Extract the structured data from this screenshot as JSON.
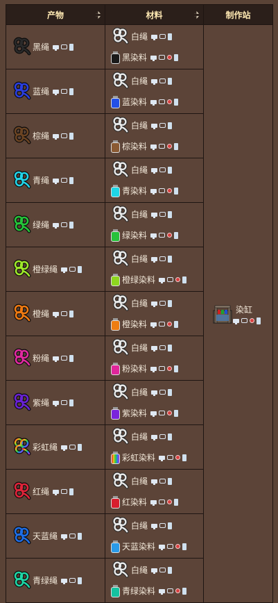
{
  "headers": {
    "product": "产物",
    "materials": "材料",
    "station": "制作站"
  },
  "station": {
    "name": "染缸"
  },
  "material_rope": "白绳",
  "rows": [
    {
      "product": "黑绳",
      "dye": "黑染料",
      "color": "#2a2a2a",
      "dyeColor": "#1a1a1a"
    },
    {
      "product": "蓝绳",
      "dye": "蓝染料",
      "color": "#2a3fe0",
      "dyeColor": "#2350e6"
    },
    {
      "product": "棕绳",
      "dye": "棕染料",
      "color": "#6b4423",
      "dyeColor": "#8a5a33"
    },
    {
      "product": "青绳",
      "dye": "青染料",
      "color": "#22d4e8",
      "dyeColor": "#1fd6e6"
    },
    {
      "product": "绿绳",
      "dye": "绿染料",
      "color": "#26c43a",
      "dyeColor": "#27c23a"
    },
    {
      "product": "橙绿绳",
      "dye": "橙绿染料",
      "color": "#9ee82a",
      "dyeColor": "#8ed61f"
    },
    {
      "product": "橙绳",
      "dye": "橙染料",
      "color": "#f07a12",
      "dyeColor": "#ee7d12"
    },
    {
      "product": "粉绳",
      "dye": "粉染料",
      "color": "#e02aa0",
      "dyeColor": "#e0269a"
    },
    {
      "product": "紫绳",
      "dye": "紫染料",
      "color": "#6a22d6",
      "dyeColor": "#7a24dc"
    },
    {
      "product": "彩虹绳",
      "dye": "彩虹染料",
      "color": "#e04040",
      "dyeColor": "#c03cc0",
      "rainbow": true
    },
    {
      "product": "红绳",
      "dye": "红染料",
      "color": "#e0243a",
      "dyeColor": "#d81e2e"
    },
    {
      "product": "天蓝绳",
      "dye": "天蓝染料",
      "color": "#1e6ee6",
      "dyeColor": "#2a9ae8"
    },
    {
      "product": "青绿绳",
      "dye": "青绿染料",
      "color": "#1ed6a6",
      "dyeColor": "#14c2a0"
    }
  ]
}
